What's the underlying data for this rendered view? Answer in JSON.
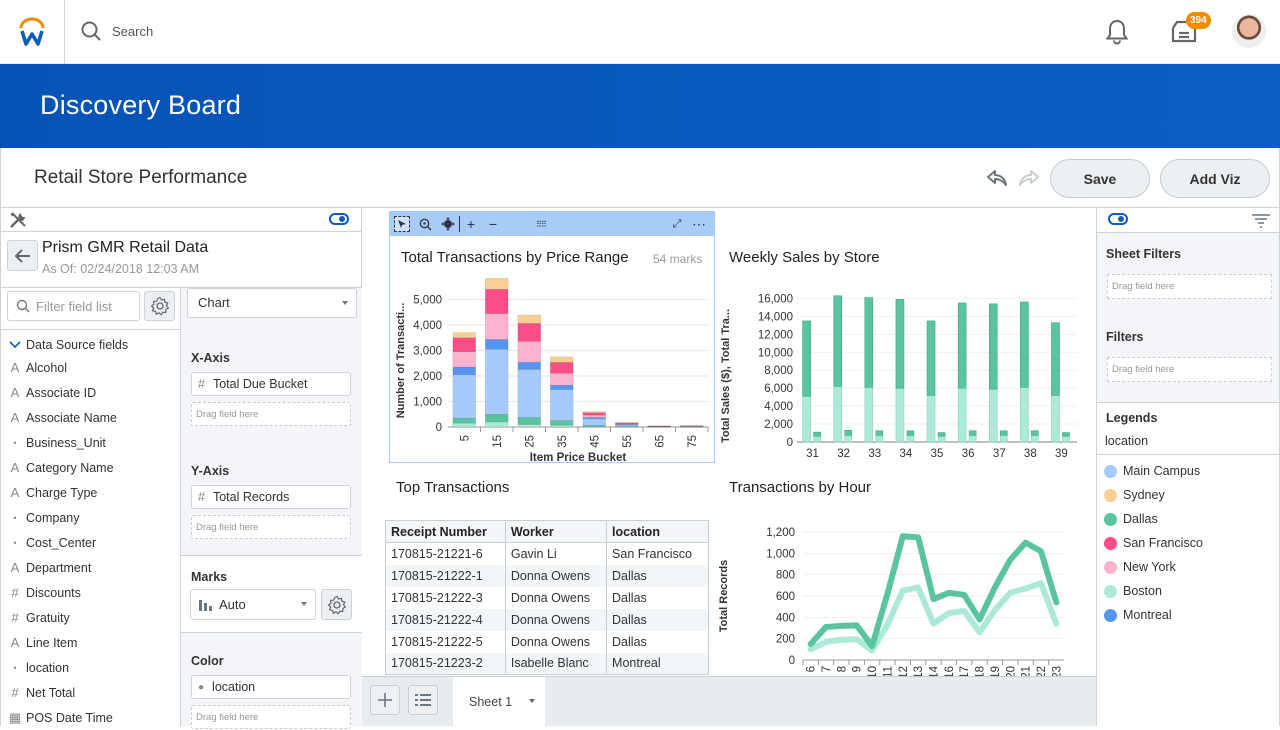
{
  "topbar": {
    "search_placeholder": "Search",
    "inbox_badge": "394",
    "icons": [
      "workday-logo-icon",
      "search-icon",
      "bell-icon",
      "inbox-icon",
      "user-avatar"
    ]
  },
  "banner": {
    "title": "Discovery Board"
  },
  "board": {
    "title": "Retail Store Performance",
    "undo_icon": "undo-icon",
    "redo_icon": "redo-icon",
    "save_label": "Save",
    "add_viz_label": "Add Viz"
  },
  "data_source": {
    "name": "Prism GMR Retail Data",
    "as_of": "As Of: 02/24/2018 12:03 AM",
    "filter_placeholder": "Filter field list",
    "section_label": "Data Source fields",
    "fields": [
      {
        "icon": "A",
        "type": "text",
        "label": "Alcohol"
      },
      {
        "icon": "A",
        "type": "text",
        "label": "Associate ID"
      },
      {
        "icon": "A",
        "type": "text",
        "label": "Associate Name"
      },
      {
        "icon": "•",
        "type": "instance",
        "label": "Business_Unit"
      },
      {
        "icon": "A",
        "type": "text",
        "label": "Category Name"
      },
      {
        "icon": "A",
        "type": "text",
        "label": "Charge Type"
      },
      {
        "icon": "•",
        "type": "instance",
        "label": "Company"
      },
      {
        "icon": "•",
        "type": "instance",
        "label": "Cost_Center"
      },
      {
        "icon": "A",
        "type": "text",
        "label": "Department"
      },
      {
        "icon": "#",
        "type": "numeric",
        "label": "Discounts"
      },
      {
        "icon": "#",
        "type": "numeric",
        "label": "Gratuity"
      },
      {
        "icon": "A",
        "type": "text",
        "label": "Line Item"
      },
      {
        "icon": "•",
        "type": "instance",
        "label": "location"
      },
      {
        "icon": "#",
        "type": "numeric",
        "label": "Net Total"
      },
      {
        "icon": "▦",
        "type": "date",
        "label": "POS Date Time"
      }
    ]
  },
  "config": {
    "viz_type": "Chart",
    "x_axis_label": "X-Axis",
    "x_axis_field": "Total Due Bucket",
    "y_axis_label": "Y-Axis",
    "y_axis_field": "Total Records",
    "drag_placeholder": "Drag field here",
    "marks_label": "Marks",
    "marks_value": "Auto",
    "color_label": "Color",
    "color_field": "location"
  },
  "colors": {
    "Main Campus": "#a4cbfb",
    "Sydney": "#fbcf94",
    "Dallas": "#5ac4a1",
    "San Francisco": "#fb4d86",
    "New York": "#fcb3cf",
    "Boston": "#ade9d8",
    "Montreal": "#5796f0",
    "brand_blue": "#0b5cbf",
    "badge_orange": "#f38b00"
  },
  "chart_data": [
    {
      "type": "bar",
      "stacked": true,
      "title": "Total Transactions by Price Range",
      "marks_count": "54 marks",
      "xlabel": "Item Price Bucket",
      "ylabel": "Number of Transacti...",
      "ylim": [
        0,
        6000
      ],
      "yticks": [
        0,
        1000,
        2000,
        3000,
        4000,
        5000
      ],
      "ytick_labels": [
        "0",
        "1,000",
        "2,000",
        "3,000",
        "4,000",
        "5,000"
      ],
      "categories": [
        "5",
        "15",
        "25",
        "35",
        "45",
        "55",
        "65",
        "75"
      ],
      "series": [
        {
          "name": "Boston",
          "values": [
            150,
            200,
            100,
            70,
            20,
            5,
            2,
            2
          ]
        },
        {
          "name": "Dallas",
          "values": [
            200,
            300,
            280,
            180,
            40,
            10,
            3,
            3
          ]
        },
        {
          "name": "Main Campus",
          "values": [
            1700,
            2550,
            1880,
            1220,
            260,
            60,
            10,
            12
          ]
        },
        {
          "name": "Montreal",
          "values": [
            300,
            380,
            280,
            170,
            50,
            25,
            5,
            5
          ]
        },
        {
          "name": "New York",
          "values": [
            600,
            1020,
            820,
            470,
            100,
            25,
            8,
            10
          ]
        },
        {
          "name": "San Francisco",
          "values": [
            550,
            950,
            700,
            420,
            90,
            35,
            12,
            15
          ]
        },
        {
          "name": "Sydney",
          "values": [
            200,
            430,
            330,
            220,
            40,
            20,
            10,
            13
          ]
        }
      ],
      "grid": true
    },
    {
      "type": "bar",
      "title": "Weekly Sales by Store",
      "ylabel": "Total Sales ($), Total Tra...",
      "ylim": [
        0,
        16500
      ],
      "yticks": [
        0,
        2000,
        4000,
        6000,
        8000,
        10000,
        12000,
        14000,
        16000
      ],
      "ytick_labels": [
        "0",
        "2,000",
        "4,000",
        "6,000",
        "8,000",
        "10,000",
        "12,000",
        "14,000",
        "16,000"
      ],
      "categories": [
        "31",
        "32",
        "33",
        "34",
        "35",
        "36",
        "37",
        "38",
        "39"
      ],
      "series": [
        {
          "name": "Total Sales ($) - Boston",
          "measure": "sales",
          "location": "Boston",
          "values": [
            5100,
            6200,
            6100,
            6000,
            5200,
            6000,
            5900,
            6100,
            5200
          ]
        },
        {
          "name": "Total Sales ($) - Dallas",
          "measure": "sales",
          "location": "Dallas",
          "values": [
            8400,
            10100,
            10000,
            9900,
            8300,
            9500,
            9500,
            9500,
            8100
          ]
        },
        {
          "name": "Total Transactions - Boston",
          "measure": "transactions",
          "location": "Boston",
          "values": [
            650,
            750,
            750,
            750,
            650,
            750,
            750,
            750,
            650
          ]
        },
        {
          "name": "Total Transactions - Dallas",
          "measure": "transactions",
          "location": "Dallas",
          "values": [
            450,
            550,
            500,
            500,
            400,
            500,
            500,
            500,
            400
          ]
        }
      ],
      "grid": true
    },
    {
      "type": "line",
      "title": "Transactions by Hour",
      "ylabel": "Total Records",
      "ylim": [
        0,
        1200
      ],
      "yticks": [
        0,
        200,
        400,
        600,
        800,
        1000,
        1200
      ],
      "ytick_labels": [
        "0",
        "200",
        "400",
        "600",
        "800",
        "1,000",
        "1,200"
      ],
      "x": [
        "6",
        "7",
        "8",
        "9",
        "10",
        "11",
        "12",
        "13",
        "14",
        "16",
        "17",
        "18",
        "19",
        "20",
        "21",
        "22",
        "23"
      ],
      "series": [
        {
          "name": "Dallas",
          "values": [
            150,
            310,
            320,
            325,
            130,
            620,
            1160,
            1150,
            570,
            630,
            610,
            380,
            680,
            940,
            1100,
            1020,
            540
          ]
        },
        {
          "name": "Boston",
          "values": [
            100,
            170,
            190,
            195,
            90,
            330,
            650,
            680,
            340,
            440,
            460,
            260,
            470,
            630,
            670,
            720,
            340
          ]
        }
      ],
      "grid": true
    }
  ],
  "top_transactions": {
    "title": "Top Transactions",
    "columns": [
      "Receipt Number",
      "Worker",
      "location"
    ],
    "rows": [
      [
        "170815-21221-6",
        "Gavin Li",
        "San Francisco"
      ],
      [
        "170815-21222-1",
        "Donna Owens",
        "Dallas"
      ],
      [
        "170815-21222-3",
        "Donna Owens",
        "Dallas"
      ],
      [
        "170815-21222-4",
        "Donna Owens",
        "Dallas"
      ],
      [
        "170815-21222-5",
        "Donna Owens",
        "Dallas"
      ],
      [
        "170815-21223-2",
        "Isabelle Blanc",
        "Montreal"
      ]
    ]
  },
  "sheets": {
    "active": "Sheet 1"
  },
  "right_panel": {
    "sheet_filters_label": "Sheet Filters",
    "filters_label": "Filters",
    "drag_placeholder": "Drag field here",
    "legends_label": "Legends",
    "legend_field": "location",
    "legend_items": [
      {
        "label": "Main Campus",
        "color": "#a4cbfb"
      },
      {
        "label": "Sydney",
        "color": "#fbcf94"
      },
      {
        "label": "Dallas",
        "color": "#5ac4a1"
      },
      {
        "label": "San Francisco",
        "color": "#fb4d86"
      },
      {
        "label": "New York",
        "color": "#fcb3cf"
      },
      {
        "label": "Boston",
        "color": "#ade9d8"
      },
      {
        "label": "Montreal",
        "color": "#5796f0"
      }
    ]
  }
}
